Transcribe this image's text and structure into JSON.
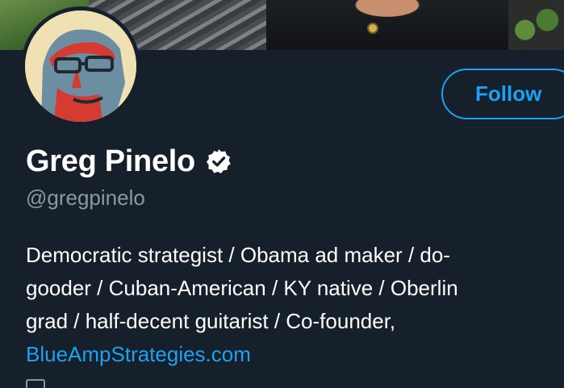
{
  "colors": {
    "background": "#15202b",
    "accent": "#1da1f2",
    "secondary_text": "#8899a6",
    "primary_text": "#ffffff"
  },
  "profile": {
    "display_name": "Greg Pinelo",
    "handle": "@gregpinelo",
    "verified": true,
    "follow_label": "Follow",
    "bio_lines": [
      "Democratic strategist / Obama ad maker / do-",
      "gooder / Cuban-American / KY native / Oberlin",
      "grad / half-decent guitarist / Co-founder,"
    ],
    "bio_link": "BlueAmpStrategies.com"
  },
  "icons": {
    "verified": "verified-badge-icon",
    "meta": "calendar-icon"
  }
}
